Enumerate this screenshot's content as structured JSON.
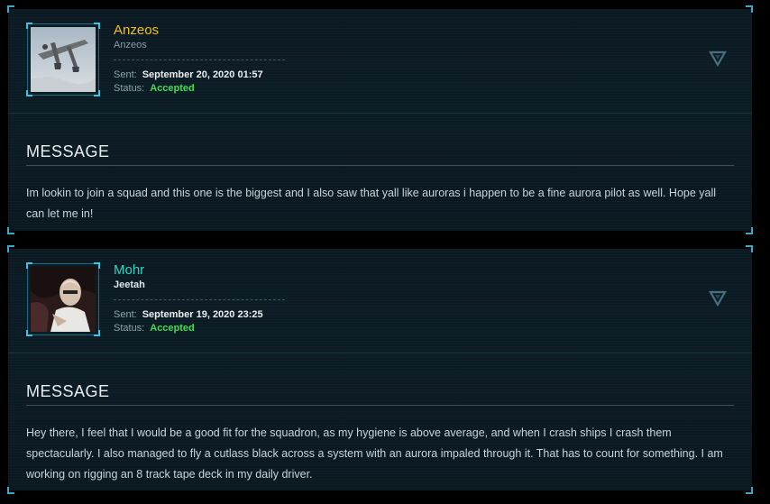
{
  "messages": [
    {
      "handle": "Anzeos",
      "org": "Anzeos",
      "sent_label": "Sent:",
      "sent_value": "September 20, 2020 01:57",
      "status_label": "Status:",
      "status_value": "Accepted",
      "section_title": "MESSAGE",
      "text": "Im lookin to join a squad and this one is the biggest and I also saw that yall like auroras i happen to be a fine aurora pilot as well. Hope yall can let me in!"
    },
    {
      "handle": "Mohr",
      "org": "Jeetah",
      "sent_label": "Sent:",
      "sent_value": "September 19, 2020 23:25",
      "status_label": "Status:",
      "status_value": "Accepted",
      "section_title": "MESSAGE",
      "text": "Hey there, I feel that I would be a good fit for the squadron, as my hygiene is above average, and when I crash ships I crash them spectacularly. I also managed to fly a cutlass black across a system with an aurora impaled through it. That has to count for something. I am working on rigging an 8 track tape deck in my daily driver."
    }
  ],
  "colors": {
    "accent": "#3aa9c7",
    "handle_gold": "#f1c21b",
    "handle_teal": "#2fd6c8",
    "status_accepted": "#3de04f"
  }
}
